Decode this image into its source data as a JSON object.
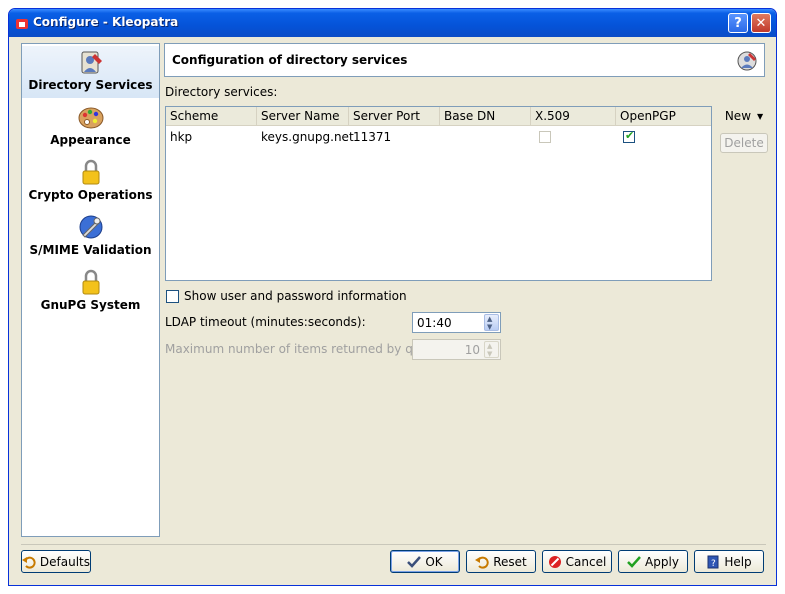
{
  "window": {
    "title": "Configure - Kleopatra"
  },
  "sidebar": {
    "items": [
      {
        "label": "Directory Services",
        "icon": "directory-services-icon"
      },
      {
        "label": "Appearance",
        "icon": "palette-icon"
      },
      {
        "label": "Crypto Operations",
        "icon": "padlock-icon"
      },
      {
        "label": "S/MIME Validation",
        "icon": "smime-validation-icon"
      },
      {
        "label": "GnuPG System",
        "icon": "padlock-icon"
      }
    ]
  },
  "main": {
    "header_title": "Configuration of directory services",
    "directory_label": "Directory services:",
    "table": {
      "columns": [
        "Scheme",
        "Server Name",
        "Server Port",
        "Base DN",
        "X.509",
        "OpenPGP"
      ],
      "rows": [
        {
          "scheme": "hkp",
          "server_name": "keys.gnupg.net",
          "server_port": "11371",
          "base_dn": "",
          "x509": false,
          "openpgp": true
        }
      ]
    },
    "new_button": "New",
    "delete_button": "Delete",
    "show_user_password": "Show user and password information",
    "ldap_timeout_label": "LDAP timeout (minutes:seconds):",
    "ldap_timeout_value": "01:40",
    "max_items_label": "Maximum number of items returned by query:",
    "max_items_value": "10"
  },
  "buttons": {
    "defaults": "Defaults",
    "ok": "OK",
    "reset": "Reset",
    "cancel": "Cancel",
    "apply": "Apply",
    "help": "Help"
  },
  "colors": {
    "titlebar": "#0553d8",
    "dialog_bg": "#ece9d8",
    "check_green": "#21a121"
  }
}
